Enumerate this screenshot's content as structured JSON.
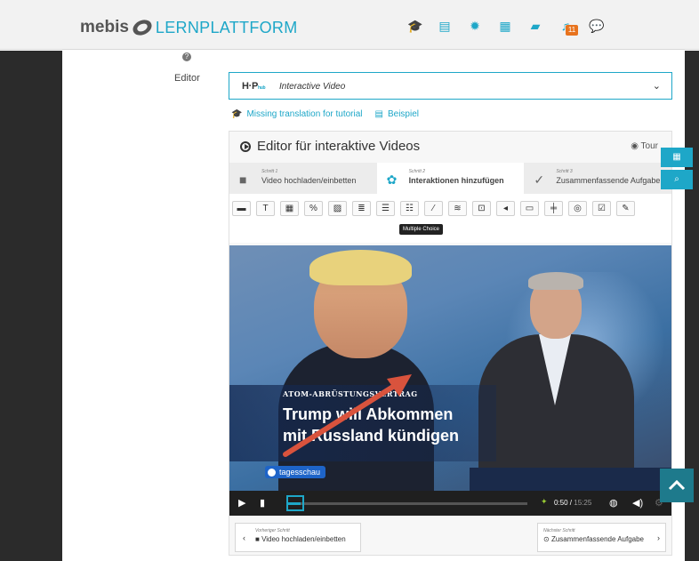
{
  "header": {
    "brand": "mebis",
    "product": "LERNPLATTFORM",
    "notification_count": "11"
  },
  "form": {
    "editor_label": "Editor",
    "selected_type": "Interactive Video",
    "h5p_logo": "H·P"
  },
  "links": {
    "tutorial": "Missing translation for tutorial",
    "example": "Beispiel"
  },
  "panel": {
    "title": "Editor für interaktive Videos",
    "tour": "Tour"
  },
  "steps": [
    {
      "number": "Schritt 1",
      "label": "Video hochladen/einbetten"
    },
    {
      "number": "Schritt 2",
      "label": "Interaktionen hinzufügen"
    },
    {
      "number": "Schritt 3",
      "label": "Zusammenfassende Aufgabe"
    }
  ],
  "tooltip": "Multiple Choice",
  "video": {
    "kicker": "ATOM-ABRÜSTUNGSVERTRAG",
    "headline_line1": "Trump will Abkommen",
    "headline_line2": "mit Russland kündigen",
    "broadcaster": "tagesschau",
    "current_time": "0:50",
    "total_time": "15:25",
    "progress": 0.054
  },
  "navigation": {
    "prev_label": "Vorheriger Schritt",
    "prev_value": "Video hochladen/einbetten",
    "next_label": "Nächster Schritt",
    "next_value": "Zusammenfassende Aufgabe"
  },
  "colors": {
    "accent": "#1ea7c8",
    "dark": "#2b2b2b",
    "badge": "#e8731e",
    "arrow": "#d9533d"
  }
}
